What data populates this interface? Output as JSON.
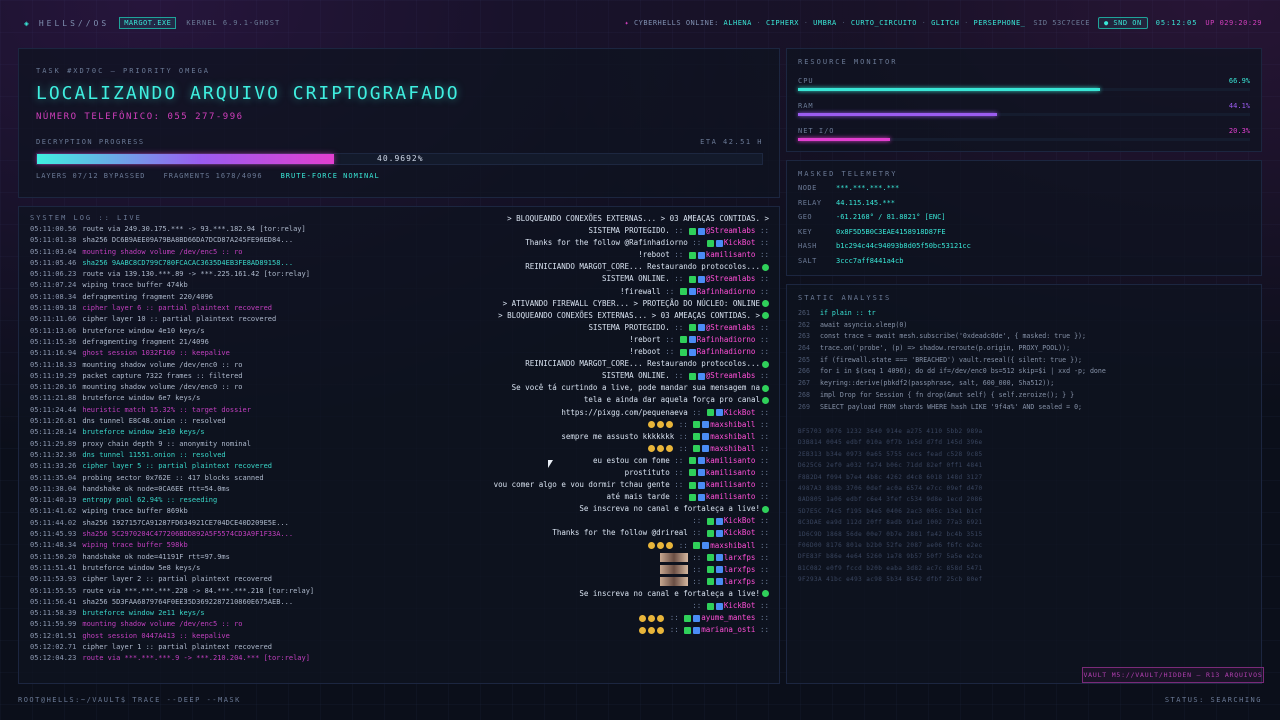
{
  "topbar": {
    "brand": "HELLS//OS",
    "exe_chip": "MARGOT.EXE",
    "kernel": "KERNEL 6.9.1-GHOST",
    "online_label": "CYBERHELLS ONLINE:",
    "users": [
      "ALHENA",
      "CIPHERX",
      "UMBRA",
      "CURTO_CIRCUITO",
      "GLITCH",
      "PERSEPHONE_"
    ],
    "sid": "SID 53C7CECE",
    "snd": "SND ON",
    "clock": "05:12:05",
    "uptime": "UP 029:20:29"
  },
  "task": {
    "kicker": "TASK #XD70C — PRIORITY OMEGA",
    "title": "LOCALIZANDO ARQUIVO CRIPTOGRAFADO",
    "phone": "NÚMERO TELEFÔNICO: 055 277-996",
    "progress_label": "DECRYPTION PROGRESS",
    "eta": "ETA 42.51 H",
    "progress_value": 40.9692,
    "progress_text": "40.9692%",
    "layers": "LAYERS 07/12 BYPASSED",
    "fragments": "FRAGMENTS 1678/4096",
    "status": "BRUTE-FORCE NOMINAL"
  },
  "log": {
    "header": "SYSTEM LOG :: LIVE",
    "lines": [
      {
        "ts": "05:11:00.56",
        "text": "route via 249.30.175.*** -> 93.***.182.94 [tor:relay]",
        "c": "w"
      },
      {
        "ts": "05:11:01.38",
        "text": "sha256 DC6B9AEE09A79BA8BD66DA7DCD87A245FE96ED84...",
        "c": "w"
      },
      {
        "ts": "05:11:03.04",
        "text": "mounting shadow volume /dev/enc5 :: ro",
        "c": "m"
      },
      {
        "ts": "05:11:05.46",
        "text": "sha256 9AABC8CD799C780FCACAC3635D4EB3FE8AD89158...",
        "c": "t"
      },
      {
        "ts": "05:11:06.23",
        "text": "route via 139.130.***.89 -> ***.225.161.42 [tor:relay]",
        "c": "w"
      },
      {
        "ts": "05:11:07.24",
        "text": "wiping trace buffer 474kb",
        "c": "w"
      },
      {
        "ts": "05:11:08.34",
        "text": "defragmenting fragment 220/4096",
        "c": "w"
      },
      {
        "ts": "05:11:09.18",
        "text": "cipher layer 6 :: partial plaintext recovered",
        "c": "m"
      },
      {
        "ts": "05:11:11.66",
        "text": "cipher layer 10 :: partial plaintext recovered",
        "c": "w"
      },
      {
        "ts": "05:11:13.06",
        "text": "bruteforce window 4e10 keys/s",
        "c": "w"
      },
      {
        "ts": "05:11:15.36",
        "text": "defragmenting fragment 21/4096",
        "c": "w"
      },
      {
        "ts": "05:11:16.94",
        "text": "ghost session 1032F160 :: keepalive",
        "c": "m"
      },
      {
        "ts": "05:11:18.33",
        "text": "mounting shadow volume /dev/enc0 :: ro",
        "c": "w"
      },
      {
        "ts": "05:11:19.29",
        "text": "packet capture 7322 frames :: filtered",
        "c": "w"
      },
      {
        "ts": "05:11:20.16",
        "text": "mounting shadow volume /dev/enc0 :: ro",
        "c": "w"
      },
      {
        "ts": "05:11:21.88",
        "text": "bruteforce window 6e7 keys/s",
        "c": "w"
      },
      {
        "ts": "05:11:24.44",
        "text": "heuristic match 15.32% :: target dossier",
        "c": "m"
      },
      {
        "ts": "05:11:26.81",
        "text": "dns tunnel E8C48.onion :: resolved",
        "c": "w"
      },
      {
        "ts": "05:11:28.14",
        "text": "bruteforce window 3e10 keys/s",
        "c": "t"
      },
      {
        "ts": "05:11:29.89",
        "text": "proxy chain depth 9 :: anonymity nominal",
        "c": "w"
      },
      {
        "ts": "05:11:32.36",
        "text": "dns tunnel 11551.onion :: resolved",
        "c": "t"
      },
      {
        "ts": "05:11:33.26",
        "text": "cipher layer 5 :: partial plaintext recovered",
        "c": "t"
      },
      {
        "ts": "05:11:35.04",
        "text": "probing sector 0x762E :: 417 blocks scanned",
        "c": "w"
      },
      {
        "ts": "05:11:38.04",
        "text": "handshake ok node=0CA6EE rtt=54.0ms",
        "c": "w"
      },
      {
        "ts": "05:11:40.19",
        "text": "entropy pool 62.94% :: reseeding",
        "c": "t"
      },
      {
        "ts": "05:11:41.62",
        "text": "wiping trace buffer 869kb",
        "c": "w"
      },
      {
        "ts": "05:11:44.02",
        "text": "sha256 1927157CA91287FD634921CE704DCE40D209E5E...",
        "c": "w"
      },
      {
        "ts": "05:11:45.93",
        "text": "sha256 5C2970204C477206BDD892A5F5574CD3A9F1F33A...",
        "c": "m"
      },
      {
        "ts": "05:11:48.34",
        "text": "wiping trace buffer 598kb",
        "c": "m"
      },
      {
        "ts": "05:11:50.20",
        "text": "handshake ok node=41191F rtt=97.9ms",
        "c": "w"
      },
      {
        "ts": "05:11:51.41",
        "text": "bruteforce window 5e8 keys/s",
        "c": "w"
      },
      {
        "ts": "05:11:53.93",
        "text": "cipher layer 2 :: partial plaintext recovered",
        "c": "w"
      },
      {
        "ts": "05:11:55.55",
        "text": "route via ***.***.***.228 -> 84.***.***.218 [tor:relay]",
        "c": "w"
      },
      {
        "ts": "05:11:56.41",
        "text": "sha256 5D3FAA6879764F0EE35D3692287210860E675AEB...",
        "c": "w"
      },
      {
        "ts": "05:11:58.39",
        "text": "bruteforce window 2e11 keys/s",
        "c": "t"
      },
      {
        "ts": "05:11:59.99",
        "text": "mounting shadow volume /dev/enc5 :: ro",
        "c": "m"
      },
      {
        "ts": "05:12:01.51",
        "text": "ghost session 0447A413 :: keepalive",
        "c": "m"
      },
      {
        "ts": "05:12:02.71",
        "text": "cipher layer 1 :: partial plaintext recovered",
        "c": "w"
      },
      {
        "ts": "05:12:04.23",
        "text": "route via ***.***.***.9 -> ***.210.204.*** [tor:relay]",
        "c": "m"
      }
    ]
  },
  "chat": [
    {
      "kind": "faded",
      "text": "> BLOQUEANDO CONEXÕES EXTERNAS... > 03 AMEAÇAS CONTIDAS. >"
    },
    {
      "kind": "msg",
      "text": "SISTEMA PROTEGIDO.",
      "user": "@Streamlabs"
    },
    {
      "kind": "msg",
      "text": "Thanks for the follow @Rafinhadiorno",
      "user": "KickBot"
    },
    {
      "kind": "msg",
      "text": "!reboot",
      "user": "kamilisanto"
    },
    {
      "kind": "sys",
      "text": "REINICIANDO MARGOT_CORE... Restaurando protocolos..."
    },
    {
      "kind": "msg",
      "text": "SISTEMA ONLINE.",
      "user": "@Streamlabs"
    },
    {
      "kind": "msg",
      "text": "!firewall",
      "user": "Rafinhadiorno"
    },
    {
      "kind": "sys",
      "text": "> ATIVANDO FIREWALL CYBER... > PROTEÇÃO DO NÚCLEO: ONLINE"
    },
    {
      "kind": "sys",
      "text": "> BLOQUEANDO CONEXÕES EXTERNAS... > 03 AMEAÇAS CONTIDAS. >"
    },
    {
      "kind": "msg",
      "text": "SISTEMA PROTEGIDO.",
      "user": "@Streamlabs"
    },
    {
      "kind": "msg",
      "text": "!rebort",
      "user": "Rafinhadiorno"
    },
    {
      "kind": "msg",
      "text": "!reboot",
      "user": "Rafinhadiorno"
    },
    {
      "kind": "sys",
      "text": "REINICIANDO MARGOT_CORE... Restaurando protocolos..."
    },
    {
      "kind": "msg",
      "text": "SISTEMA ONLINE.",
      "user": "@Streamlabs"
    },
    {
      "kind": "sys",
      "text": "Se você tá curtindo a live, pode mandar sua mensagem na"
    },
    {
      "kind": "sys",
      "text": "tela e ainda dar aquela força pro canal"
    },
    {
      "kind": "msg",
      "text": "https://pixgg.com/pequenaeva",
      "user": "KickBot"
    },
    {
      "kind": "emo",
      "text": "",
      "user": "maxshiball"
    },
    {
      "kind": "msg",
      "text": "sempre me assusto kkkkkkk",
      "user": "maxshiball"
    },
    {
      "kind": "emo",
      "text": "",
      "user": "maxshiball"
    },
    {
      "kind": "msg",
      "text": "eu estou com fome",
      "user": "kamilisanto"
    },
    {
      "kind": "msg",
      "text": "prostituto",
      "user": "kamilisanto"
    },
    {
      "kind": "msg",
      "text": "vou comer algo e vou dormir tchau gente",
      "user": "kamilisanto"
    },
    {
      "kind": "msg",
      "text": "até mais tarde",
      "user": "kamilisanto"
    },
    {
      "kind": "sys",
      "text": "Se inscreva no canal e fortaleça a live!"
    },
    {
      "kind": "msg",
      "text": "",
      "user": "KickBot"
    },
    {
      "kind": "msg",
      "text": "Thanks for the follow @drireal",
      "user": "KickBot"
    },
    {
      "kind": "emo",
      "text": "",
      "user": "maxshiball"
    },
    {
      "kind": "pic",
      "text": "",
      "user": "larxfps"
    },
    {
      "kind": "pic",
      "text": "",
      "user": "larxfps"
    },
    {
      "kind": "pic",
      "text": "",
      "user": "larxfps"
    },
    {
      "kind": "sys",
      "text": "Se inscreva no canal e fortaleça a live!"
    },
    {
      "kind": "msg",
      "text": "",
      "user": "KickBot"
    },
    {
      "kind": "emo",
      "text": "",
      "user": "ayume_mantes"
    },
    {
      "kind": "emo",
      "text": "",
      "user": "mariana_osti"
    }
  ],
  "resource": {
    "header": "RESOURCE MONITOR",
    "rows": [
      {
        "name": "CPU",
        "value": "66.9%",
        "pct": 66.9,
        "color": "#39e6d6"
      },
      {
        "name": "RAM",
        "value": "44.1%",
        "pct": 44.1,
        "color": "#9b5cf0"
      },
      {
        "name": "NET I/O",
        "value": "20.3%",
        "pct": 20.3,
        "color": "#e23fd0"
      }
    ]
  },
  "telemetry": {
    "header": "MASKED TELEMETRY",
    "rows": [
      {
        "k": "NODE",
        "v": "***.***.***.***"
      },
      {
        "k": "RELAY",
        "v": "44.115.145.***"
      },
      {
        "k": "GEO",
        "v": "-61.2168° / 81.8821° [ENC]"
      },
      {
        "k": "KEY",
        "v": "0x8F5D5B0C3EAE4158918D87FE"
      },
      {
        "k": "HASH",
        "v": "b1c294c44c94093b8d05f50bc53121cc"
      },
      {
        "k": "SALT",
        "v": "3ccc7aff8441a4cb"
      }
    ]
  },
  "static_analysis": {
    "header": "STATIC ANALYSIS",
    "code": [
      {
        "no": "261",
        "tx": "if plain :: tr",
        "hl": true
      },
      {
        "no": "262",
        "tx": "await asyncio.sleep(0)",
        "hl": false
      },
      {
        "no": "263",
        "tx": "const trace = await mesh.subscribe('0xdeadc0de', { masked: true });",
        "hl": false
      },
      {
        "no": "264",
        "tx": "trace.on('probe', (p) => shadow.reroute(p.origin, PROXY_POOL));",
        "hl": false
      },
      {
        "no": "265",
        "tx": "if (firewall.state === 'BREACHED') vault.reseal({ silent: true });",
        "hl": false
      },
      {
        "no": "266",
        "tx": "for i in $(seq 1 4096); do dd if=/dev/enc0 bs=512 skip=$i | xxd -p; done",
        "hl": false
      },
      {
        "no": "267",
        "tx": "keyring::derive(pbkdf2(passphrase, salt, 600_000, Sha512));",
        "hl": false
      },
      {
        "no": "268",
        "tx": "impl Drop for Session { fn drop(&mut self) { self.zeroize(); } }",
        "hl": false
      },
      {
        "no": "269",
        "tx": "SELECT payload FROM shards WHERE hash LIKE '9f4a%' AND sealed = 0;",
        "hl": false
      }
    ],
    "hex": [
      "BF5703  9076 1232 3640 914e a275 4110 5bb2 989a",
      "D3B814  0045 edbf 010a 0f7b 1e5d d7fd 145d 396e",
      "2EB313  b34e 0973 0a65 5755 cecs fead c528 9c85",
      "D625C6  2ef0 a032 fa74 b06c 71dd 82ef 0ff1 4841",
      "F8B2D4  f094 b7e4 4b8c 4262 d4c8 6018 148d 3127",
      "4987A3  898b 3706 0def ac0a 6574 e7cc 09ef d470",
      "8AD805  1a06 edbf c6e4 3fef c534 9d8e 1ecd 2086",
      "5D7E5C  74c5 f195 b4e5 0406 2ac3 005c 13e1 b1cf",
      "8C3DAE  ea9d 112d 20ff 8adb 91ad 1002 77a3 6921",
      "1D6C9D  1868 56de 00e7 0b7e 2881 fa42 bc4b 3515",
      "F06D00  8176 801e b2b0 52fe 2087 ae06 f6fc e2ec",
      "DFE83F  b86e 4e64 5260 1a78 9b57 50f7 5a5e e2ce",
      "B1C082  e0f9 fccd b20b eaba 3d82 ac7c 858d 5471",
      "9F293A  41bc e493 ac98 5b34 8542 dfbf 25cb 80ef"
    ]
  },
  "vault": "VAULT M5://VAULT/HIDDEN — R13 ARQUIVOS",
  "footer": {
    "prompt": "ROOT@HELLS:~/VAULT$ TRACE --DEEP --MASK",
    "status": "STATUS: SEARCHING"
  }
}
